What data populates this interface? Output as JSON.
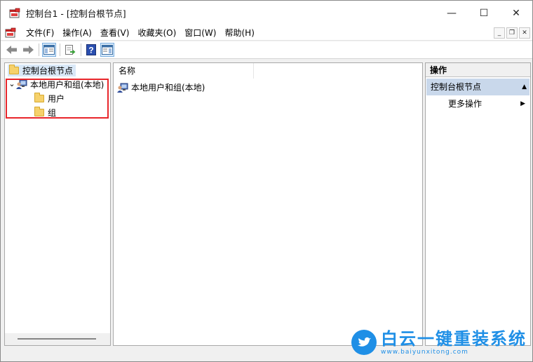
{
  "window": {
    "title": "控制台1 - [控制台根节点]",
    "controls": {
      "minimize": "—",
      "maximize": "☐",
      "close": "✕"
    }
  },
  "menubar": {
    "items": [
      "文件(F)",
      "操作(A)",
      "查看(V)",
      "收藏夹(O)",
      "窗口(W)",
      "帮助(H)"
    ],
    "mdi": {
      "minimize": "_",
      "restore": "❐",
      "close": "✕"
    }
  },
  "toolbar": {
    "buttons": [
      "back-arrow",
      "forward-arrow",
      "show-hide-tree",
      "export-list",
      "help",
      "show-hide-action-pane"
    ],
    "help_glyph": "?"
  },
  "tree": {
    "root": "控制台根节点",
    "expander": "⌄",
    "snapin": "本地用户和组(本地)",
    "children": [
      "用户",
      "组"
    ]
  },
  "list": {
    "column_header": "名称",
    "rows": [
      "本地用户和组(本地)"
    ]
  },
  "actions": {
    "header": "操作",
    "section": "控制台根节点",
    "section_caret": "▲",
    "item": "更多操作",
    "item_arrow": "▶"
  },
  "watermark": {
    "main": "白云一键重装系统",
    "sub": "www.baiyunxitong.com"
  },
  "colors": {
    "highlight": "#e8262b",
    "accent": "#1f8fe6",
    "selection": "#d9e8f7",
    "action_section": "#c9d8eb"
  }
}
